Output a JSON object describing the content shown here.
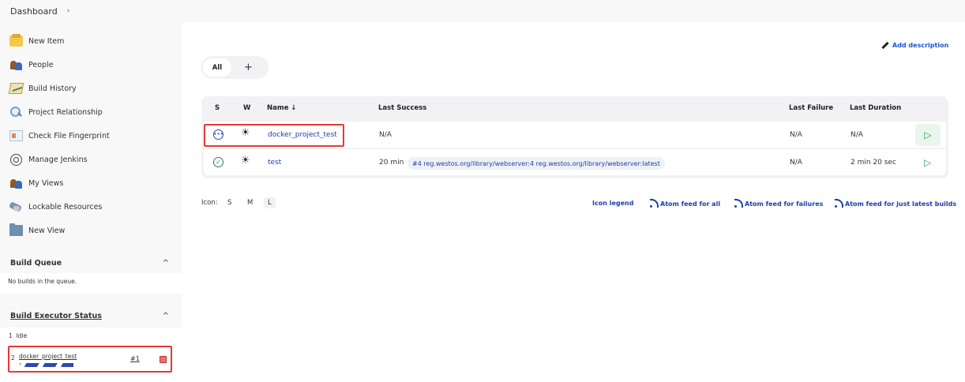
{
  "breadcrumb": {
    "root": "Dashboard",
    "separator": "›"
  },
  "sidebar": {
    "tasks": [
      {
        "label": "New Item",
        "icon": "new-item-icon"
      },
      {
        "label": "People",
        "icon": "people-icon"
      },
      {
        "label": "Build History",
        "icon": "build-history-icon"
      },
      {
        "label": "Project Relationship",
        "icon": "search-icon"
      },
      {
        "label": "Check File Fingerprint",
        "icon": "fingerprint-icon"
      },
      {
        "label": "Manage Jenkins",
        "icon": "gear-icon"
      },
      {
        "label": "My Views",
        "icon": "people-icon"
      },
      {
        "label": "Lockable Resources",
        "icon": "lock-icon"
      },
      {
        "label": "New View",
        "icon": "folder-icon"
      }
    ],
    "build_queue": {
      "title": "Build Queue",
      "caret": "^",
      "empty_text": "No builds in the queue."
    },
    "executors": {
      "title": "Build Executor Status",
      "caret": "^",
      "rows": [
        {
          "num": "1",
          "status": "Idle"
        },
        {
          "num": "2",
          "job": "docker_project_test",
          "build": "#1"
        }
      ]
    }
  },
  "main": {
    "add_description": "Add description",
    "tabs": {
      "all": "All",
      "add": "+"
    },
    "table": {
      "headers": {
        "s": "S",
        "w": "W",
        "name": "Name ↓",
        "last_success": "Last Success",
        "last_failure": "Last Failure",
        "last_duration": "Last Duration"
      },
      "rows": [
        {
          "status": "pending",
          "weather": "sunny",
          "name": "docker_project_test",
          "last_success": "N/A",
          "last_failure": "N/A",
          "last_duration": "N/A"
        },
        {
          "status": "success",
          "weather": "sunny",
          "name": "test",
          "last_success": "20 min",
          "last_success_badge": "#4 reg.westos.org/library/webserver:4 reg.westos.org/library/webserver:latest",
          "last_failure": "N/A",
          "last_duration": "2 min 20 sec"
        }
      ]
    },
    "icon_size": {
      "label": "Icon:",
      "options": [
        "S",
        "M",
        "L"
      ],
      "selected": "L"
    },
    "footer_links": {
      "legend": "Icon legend",
      "feed_all": "Atom feed for all",
      "feed_failures": "Atom feed for failures",
      "feed_latest": "Atom feed for just latest builds"
    }
  },
  "colors": {
    "link": "#1e3ea6",
    "success": "#1e8a4a",
    "highlight": "#e53935",
    "sidebar_bg": "#f8f8f9"
  }
}
